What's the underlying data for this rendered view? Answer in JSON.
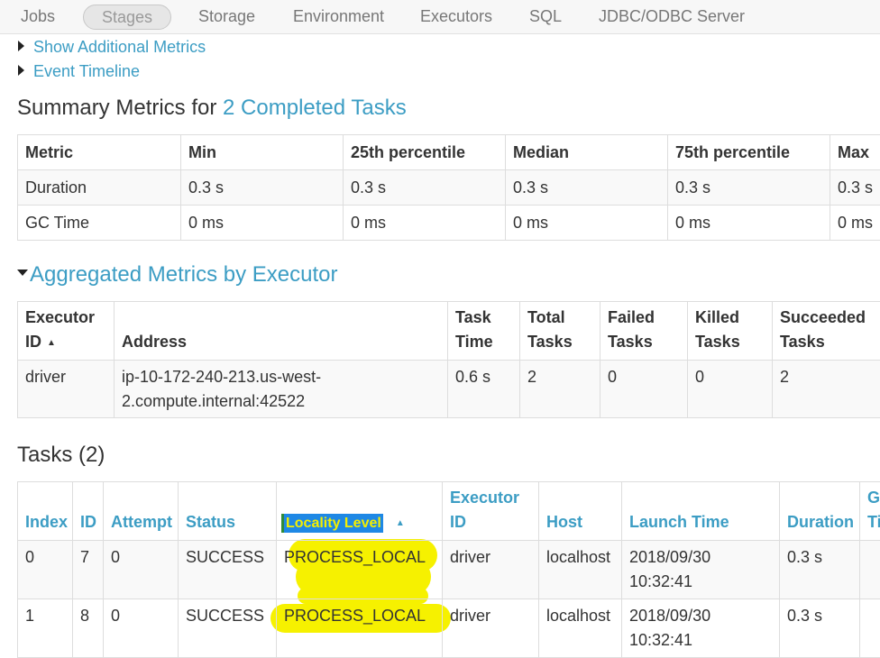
{
  "nav": {
    "items": [
      {
        "label": "Jobs",
        "active": false
      },
      {
        "label": "Stages",
        "active": true
      },
      {
        "label": "Storage",
        "active": false
      },
      {
        "label": "Environment",
        "active": false
      },
      {
        "label": "Executors",
        "active": false
      },
      {
        "label": "SQL",
        "active": false
      },
      {
        "label": "JDBC/ODBC Server",
        "active": false
      }
    ]
  },
  "toggles": {
    "additional_metrics": "Show Additional Metrics",
    "event_timeline": "Event Timeline"
  },
  "summary": {
    "title_prefix": "Summary Metrics for ",
    "title_link": "2 Completed Tasks",
    "columns": [
      "Metric",
      "Min",
      "25th percentile",
      "Median",
      "75th percentile",
      "Max"
    ],
    "rows": [
      [
        "Duration",
        "0.3 s",
        "0.3 s",
        "0.3 s",
        "0.3 s",
        "0.3 s"
      ],
      [
        "GC Time",
        "0 ms",
        "0 ms",
        "0 ms",
        "0 ms",
        "0 ms"
      ]
    ]
  },
  "aggregated": {
    "title": "Aggregated Metrics by Executor",
    "columns": {
      "executor_id_1": "Executor",
      "executor_id_2": "ID",
      "address": "Address",
      "task_time_1": "Task",
      "task_time_2": "Time",
      "total_tasks_1": "Total",
      "total_tasks_2": "Tasks",
      "failed_tasks_1": "Failed",
      "failed_tasks_2": "Tasks",
      "killed_tasks_1": "Killed",
      "killed_tasks_2": "Tasks",
      "succeeded_tasks_1": "Succeeded",
      "succeeded_tasks_2": "Tasks"
    },
    "row": {
      "executor_id": "driver",
      "address_1": "ip-10-172-240-213.us-west-",
      "address_2": "2.compute.internal:42522",
      "task_time": "0.6 s",
      "total_tasks": "2",
      "failed_tasks": "0",
      "killed_tasks": "0",
      "succeeded_tasks": "2"
    }
  },
  "tasks": {
    "title": "Tasks (2)",
    "columns": {
      "index": "Index",
      "id": "ID",
      "attempt": "Attempt",
      "status": "Status",
      "locality": "Locality Level",
      "executor_1": "Executor",
      "executor_2": "ID",
      "host": "Host",
      "launch_time": "Launch Time",
      "duration": "Duration",
      "gc_1": "G",
      "gc_2": "Ti"
    },
    "rows": [
      {
        "index": "0",
        "id": "7",
        "attempt": "0",
        "status": "SUCCESS",
        "locality": "PROCESS_LOCAL",
        "executor": "driver",
        "host": "localhost",
        "launch_1": "2018/09/30",
        "launch_2": "10:32:41",
        "duration": "0.3 s"
      },
      {
        "index": "1",
        "id": "8",
        "attempt": "0",
        "status": "SUCCESS",
        "locality": "PROCESS_LOCAL",
        "executor": "driver",
        "host": "localhost",
        "launch_1": "2018/09/30",
        "launch_2": "10:32:41",
        "duration": "0.3 s"
      }
    ]
  },
  "colors": {
    "link": "#3c9dc4",
    "highlight_yellow": "#f6f100",
    "highlight_blue": "#1e88e5"
  }
}
